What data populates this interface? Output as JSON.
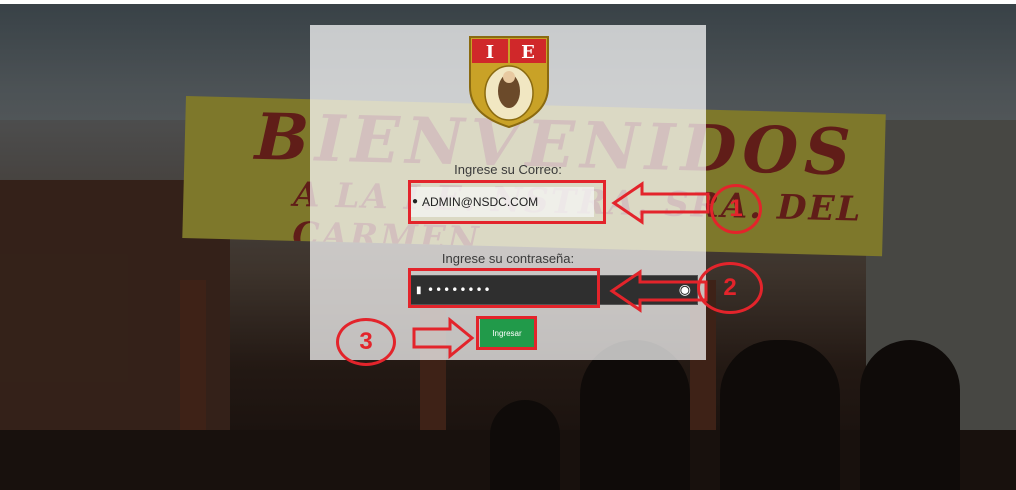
{
  "login": {
    "logo_icon": "school-crest-icon",
    "email_label": "Ingrese su Correo:",
    "email_value": "ADMIN@NSDC.COM",
    "email_icon": "user-icon",
    "password_label": "Ingrese su contraseña:",
    "password_value": "••••••••",
    "password_icon": "lock-icon",
    "toggle_icon": "eye-icon",
    "submit_label": "Ingresar"
  },
  "background": {
    "banner_title": "BIENVENIDOS",
    "banner_subtitle": "A LA I.E. NSTRA. SRA. DEL CARMEN"
  },
  "annotations": {
    "step1": "1",
    "step2": "2",
    "step3": "3",
    "color": "#e3242b"
  }
}
